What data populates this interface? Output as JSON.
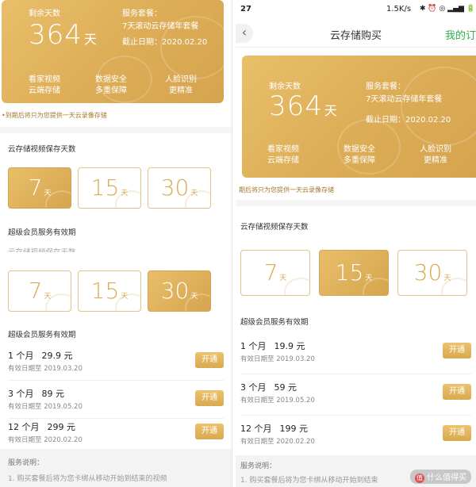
{
  "left": {
    "card": {
      "remaining_label": "剩余天数",
      "days_value": "364",
      "days_unit": "天",
      "package_label": "服务套餐：",
      "package_name": "7天滚动云存储年套餐",
      "expiry": "截止日期：2020.02.20",
      "features": [
        {
          "line1": "看家视频",
          "line2": "云端存储"
        },
        {
          "line1": "数据安全",
          "line2": "多重保障"
        },
        {
          "line1": "人脸识别",
          "line2": "更精准"
        }
      ]
    },
    "notice": "•到期后将只为您提供一天云录像存储",
    "section_days_title": "云存储视频保存天数",
    "days_options_a": [
      {
        "num": "7",
        "unit": "天"
      },
      {
        "num": "15",
        "unit": "天"
      },
      {
        "num": "30",
        "unit": "天"
      }
    ],
    "section_member_title_a": "超级会员服务有效期",
    "overlap_title": "云存储视频保存天数",
    "days_options_b": [
      {
        "num": "7",
        "unit": "天"
      },
      {
        "num": "15",
        "unit": "天"
      },
      {
        "num": "30",
        "unit": "天"
      }
    ],
    "section_member_title_b": "超级会员服务有效期",
    "plans": [
      {
        "name": "1 个月",
        "price": "29.9 元",
        "date": "有效日期至 2019.03.20",
        "button": "开通"
      },
      {
        "name": "3 个月",
        "price": "89 元",
        "date": "有效日期至 2019.05.20",
        "button": "开通"
      },
      {
        "name": "12 个月",
        "price": "299 元",
        "date": "有效日期至 2020.02.20",
        "button": "开通"
      }
    ],
    "footer_title": "服务说明：",
    "footer_text": "1. 购买套餐后将为您卡绑从移动开始到结束的视频"
  },
  "right": {
    "status": {
      "time": "27",
      "speed": "1.5K/s",
      "icons": "✱ ⏰ ◎ ▂▄▆ 🔋"
    },
    "nav": {
      "back": "‹",
      "title": "云存储购买",
      "right_link": "我的订"
    },
    "card": {
      "remaining_label": "剩余天数",
      "days_value": "364",
      "days_unit": "天",
      "package_label": "服务套餐：",
      "package_name": "7天滚动云存储年套餐",
      "expiry": "截止日期：2020.02.20",
      "features": [
        {
          "line1": "看家视频",
          "line2": "云端存储"
        },
        {
          "line1": "数据安全",
          "line2": "多重保障"
        },
        {
          "line1": "人脸识别",
          "line2": "更精准"
        }
      ]
    },
    "notice": "期后将只为您提供一天云录像存储",
    "section_days_title": "云存储视频保存天数",
    "days_options": [
      {
        "num": "7",
        "unit": "天"
      },
      {
        "num": "15",
        "unit": "天"
      },
      {
        "num": "30",
        "unit": "天"
      }
    ],
    "section_member_title": "超级会员服务有效期",
    "plans": [
      {
        "name": "1 个月",
        "price": "19.9 元",
        "date": "有效日期至 2019.03.20",
        "button": "开通"
      },
      {
        "name": "3 个月",
        "price": "59 元",
        "date": "有效日期至 2019.05.20",
        "button": "开通"
      },
      {
        "name": "12 个月",
        "price": "199 元",
        "date": "有效日期至 2020.02.20",
        "button": "开通"
      }
    ],
    "footer_title": "服务说明：",
    "footer_text": "1. 购买套餐后将为您卡绑从移动开始到结束",
    "watermark": "什么值得买"
  },
  "colors": {
    "gold": "#dcac56",
    "gold_light": "#e9bf6a",
    "green_link": "#2fb24a"
  },
  "selection": {
    "left_a_selected": 0,
    "left_b_selected": 2,
    "right_selected": 1
  }
}
